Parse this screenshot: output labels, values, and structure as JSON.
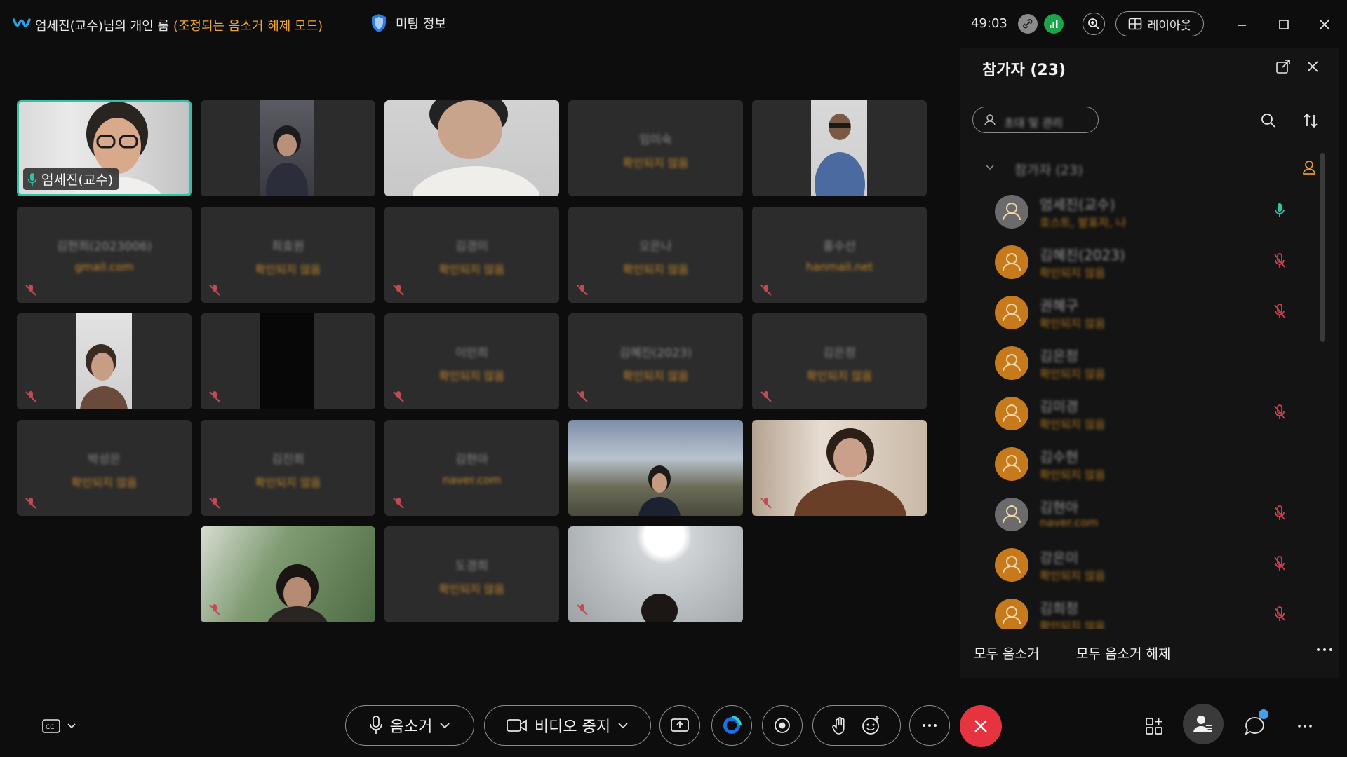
{
  "window": {
    "title_main": "엄세진(교수)님의 개인 룸",
    "title_mode": "(조정되는 음소거 해제 모드)",
    "meeting_info": "미팅 정보",
    "timer": "49:03",
    "layout_label": "레이아웃"
  },
  "tiles": [
    {
      "name": "엄세진(교수)",
      "sub": "",
      "type": "video-speaker"
    },
    {
      "name": "",
      "sub": "",
      "type": "video"
    },
    {
      "name": "",
      "sub": "",
      "type": "video"
    },
    {
      "name": "임미숙",
      "sub": "확인되지 않음",
      "type": "avatar"
    },
    {
      "name": "",
      "sub": "",
      "type": "video"
    },
    {
      "name": "김현희(2023006)",
      "sub": "gmail.com",
      "type": "avatar"
    },
    {
      "name": "최효원",
      "sub": "확인되지 않음",
      "type": "avatar"
    },
    {
      "name": "김경미",
      "sub": "확인되지 않음",
      "type": "avatar"
    },
    {
      "name": "오은나",
      "sub": "확인되지 않음",
      "type": "avatar"
    },
    {
      "name": "홍수선",
      "sub": "hanmail.net",
      "type": "avatar"
    },
    {
      "name": "",
      "sub": "",
      "type": "video"
    },
    {
      "name": "",
      "sub": "",
      "type": "video-dark"
    },
    {
      "name": "이민희",
      "sub": "확인되지 않음",
      "type": "avatar"
    },
    {
      "name": "김혜진(2023)",
      "sub": "확인되지 않음",
      "type": "avatar"
    },
    {
      "name": "김은정",
      "sub": "확인되지 않음",
      "type": "avatar"
    },
    {
      "name": "박성은",
      "sub": "확인되지 않음",
      "type": "avatar"
    },
    {
      "name": "김진희",
      "sub": "확인되지 않음",
      "type": "avatar"
    },
    {
      "name": "김현아",
      "sub": "naver.com",
      "type": "avatar"
    },
    {
      "name": "",
      "sub": "",
      "type": "video"
    },
    {
      "name": "",
      "sub": "",
      "type": "video"
    },
    {
      "name": "",
      "sub": "",
      "type": "video"
    },
    {
      "name": "도경희",
      "sub": "확인되지 않음",
      "type": "avatar"
    },
    {
      "name": "",
      "sub": "",
      "type": "video"
    }
  ],
  "panel": {
    "title": "참가자 (23)",
    "invite_label": "초대 및 관리",
    "section_label": "참가자 (23)",
    "participants": [
      {
        "name": "엄세진(교수)",
        "sub": "호스트, 발표자, 나",
        "avatar": "gray",
        "mic": "on"
      },
      {
        "name": "김혜진(2023)",
        "sub": "확인되지 않음",
        "avatar": "orange",
        "mic": "muted"
      },
      {
        "name": "권혜구",
        "sub": "확인되지 않음",
        "avatar": "orange",
        "mic": "muted"
      },
      {
        "name": "김은정",
        "sub": "확인되지 않음",
        "avatar": "orange",
        "mic": ""
      },
      {
        "name": "김미경",
        "sub": "확인되지 않음",
        "avatar": "orange",
        "mic": "muted"
      },
      {
        "name": "김수현",
        "sub": "확인되지 않음",
        "avatar": "orange",
        "mic": ""
      },
      {
        "name": "김현아",
        "sub": "naver.com",
        "avatar": "gray",
        "mic": "muted"
      },
      {
        "name": "강은미",
        "sub": "확인되지 않음",
        "avatar": "orange",
        "mic": "muted"
      },
      {
        "name": "김희정",
        "sub": "확인되지 않음",
        "avatar": "orange",
        "mic": "muted"
      }
    ],
    "mute_all": "모두 음소거",
    "unmute_all": "모두 음소거 해제"
  },
  "toolbar": {
    "mute_label": "음소거",
    "video_label": "비디오 중지"
  },
  "colors": {
    "accent_teal": "#2fc3a6",
    "end_red": "#e5343f",
    "orange_sub": "#c9892b",
    "avatar_orange": "#c67a1c"
  }
}
